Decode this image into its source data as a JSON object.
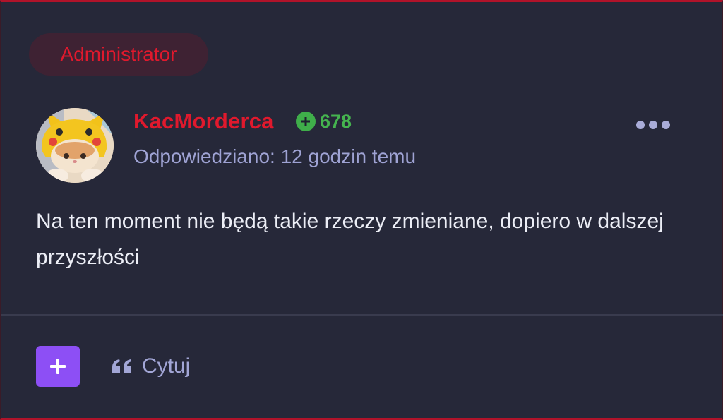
{
  "post": {
    "role_badge": "Administrator",
    "author": {
      "username": "KacMorderca",
      "reputation": "678",
      "avatar_icon": "cat-pikachu-hood-avatar"
    },
    "timestamp": "Odpowiedziano: 12 godzin temu",
    "content": "Na ten moment nie będą takie rzeczy zmieniane, dopiero w dalszej przyszłości",
    "actions": {
      "more_icon": "more-horizontal-icon",
      "react_icon": "plus-icon",
      "quote_icon": "quote-icon",
      "quote_label": "Cytuj"
    }
  },
  "colors": {
    "background": "#262839",
    "border_accent": "#b0132a",
    "admin_red": "#e0192d",
    "badge_bg": "#3e2233",
    "reputation_green": "#45b44f",
    "muted_text": "#9fa3d4",
    "body_text": "#eceef6",
    "react_purple": "#8d4ff5",
    "divider": "#393b4e"
  }
}
